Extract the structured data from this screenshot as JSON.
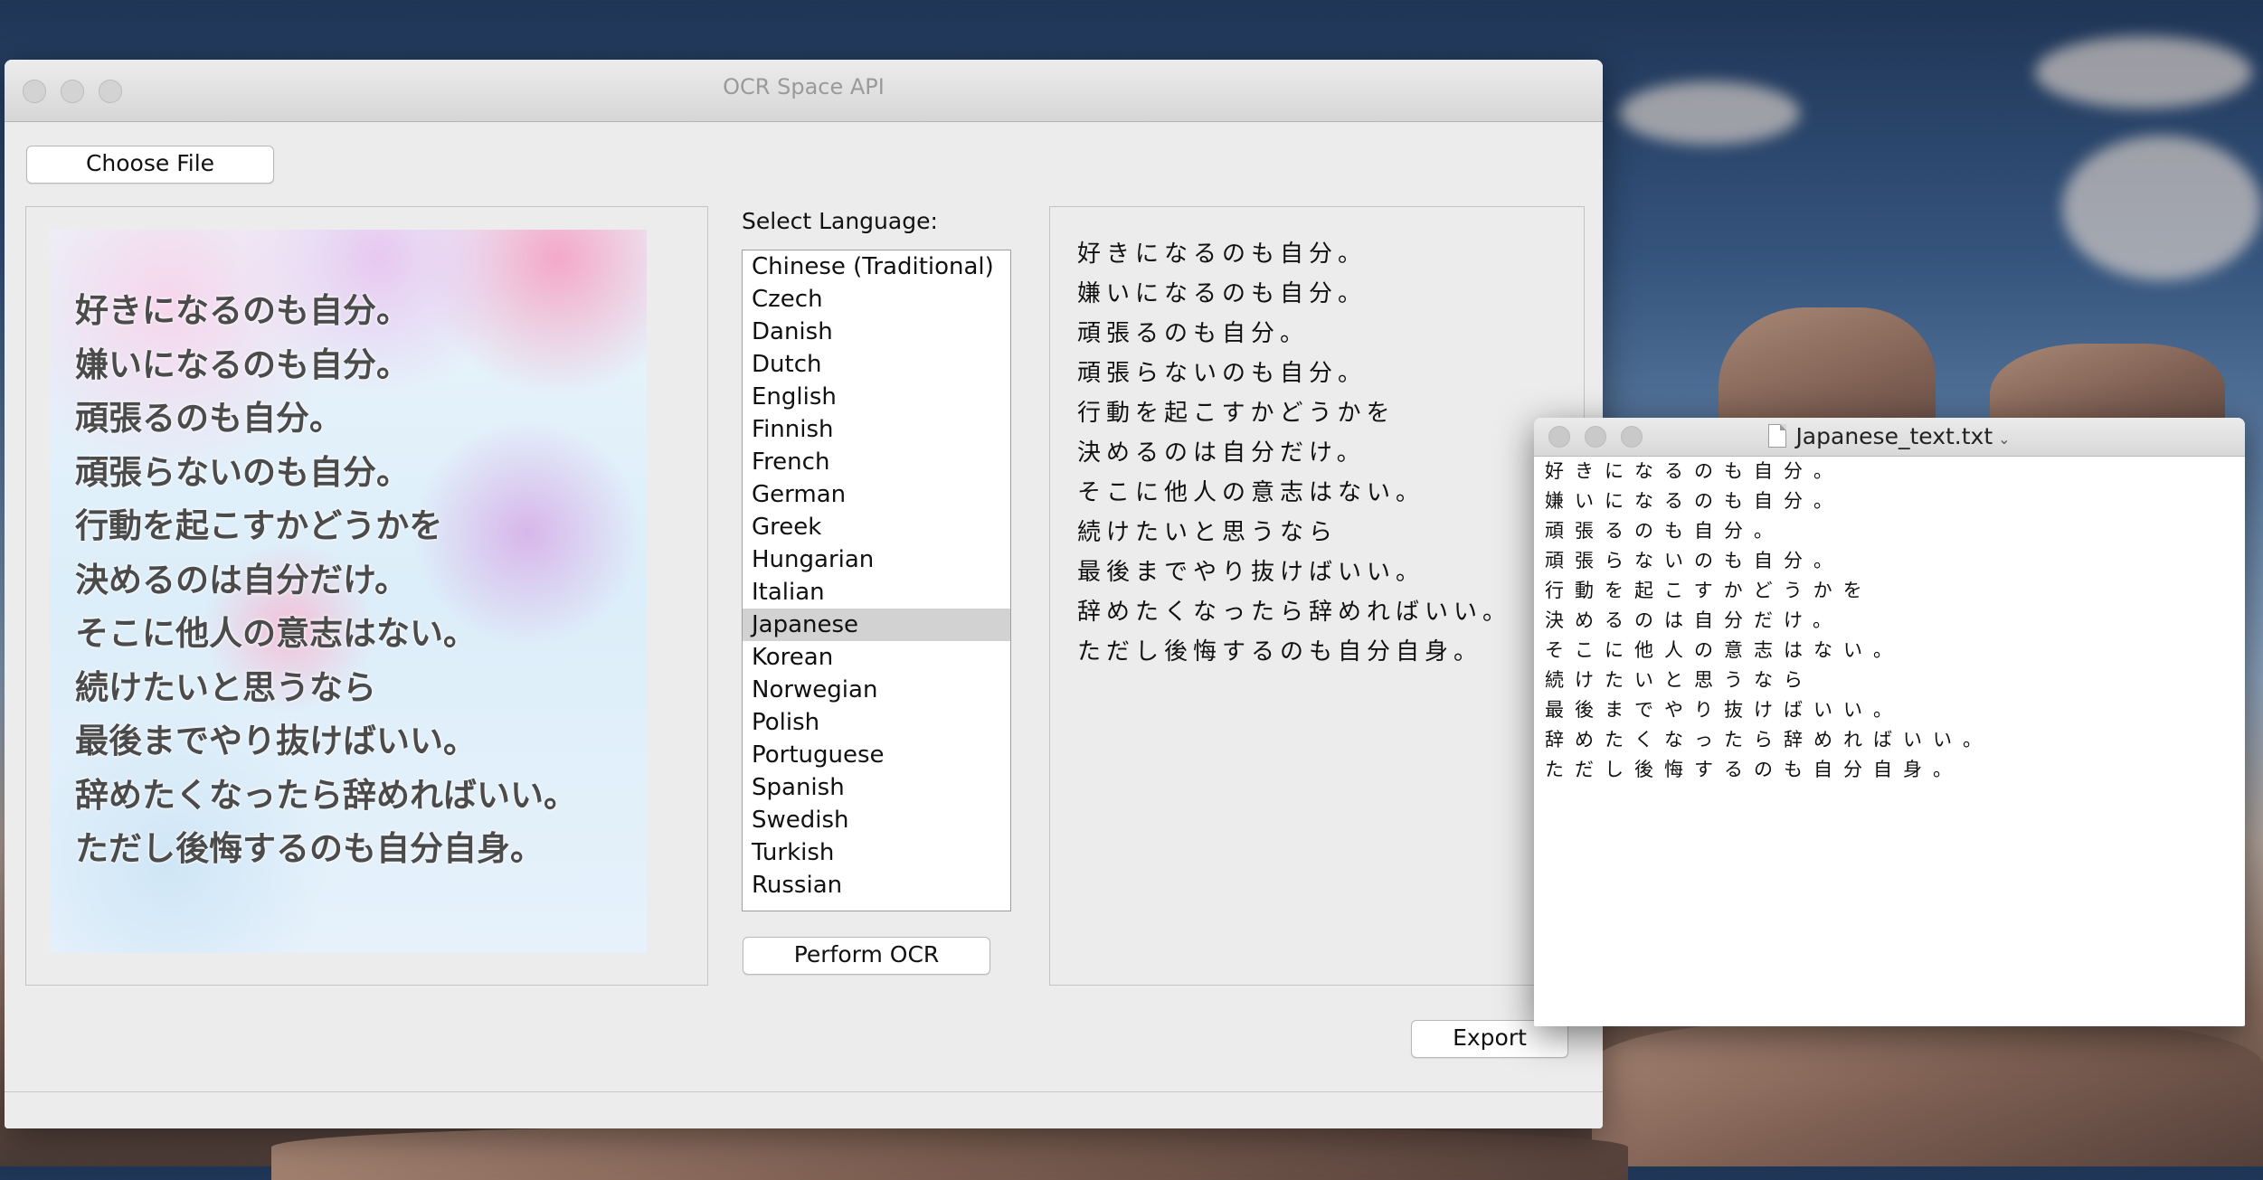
{
  "main_window": {
    "title": "OCR Space API",
    "choose_file_label": "Choose File",
    "select_language_label": "Select Language:",
    "languages": [
      {
        "label": "Chinese (Traditional)",
        "selected": false
      },
      {
        "label": "Czech",
        "selected": false
      },
      {
        "label": "Danish",
        "selected": false
      },
      {
        "label": "Dutch",
        "selected": false
      },
      {
        "label": "English",
        "selected": false
      },
      {
        "label": "Finnish",
        "selected": false
      },
      {
        "label": "French",
        "selected": false
      },
      {
        "label": "German",
        "selected": false
      },
      {
        "label": "Greek",
        "selected": false
      },
      {
        "label": "Hungarian",
        "selected": false
      },
      {
        "label": "Italian",
        "selected": false
      },
      {
        "label": "Japanese",
        "selected": true
      },
      {
        "label": "Korean",
        "selected": false
      },
      {
        "label": "Norwegian",
        "selected": false
      },
      {
        "label": "Polish",
        "selected": false
      },
      {
        "label": "Portuguese",
        "selected": false
      },
      {
        "label": "Spanish",
        "selected": false
      },
      {
        "label": "Swedish",
        "selected": false
      },
      {
        "label": "Turkish",
        "selected": false
      },
      {
        "label": "Russian",
        "selected": false
      }
    ],
    "perform_ocr_label": "Perform OCR",
    "export_label": "Export",
    "image_text_lines": [
      "好きになるのも自分。",
      "嫌いになるのも自分。",
      "頑張るのも自分。",
      "頑張らないのも自分。",
      "行動を起こすかどうかを",
      "決めるのは自分だけ。",
      "そこに他人の意志はない。",
      "続けたいと思うなら",
      "最後までやり抜けばいい。",
      "辞めたくなったら辞めればいい。",
      "ただし後悔するのも自分自身。"
    ],
    "ocr_result_lines": [
      "好きになるのも自分。",
      "嫌いになるのも自分。",
      "頑張るのも自分。",
      "頑張らないのも自分。",
      "行動を起こすかどうかを",
      "決めるのは自分だけ。",
      "そこに他人の意志はない。",
      "続けたいと思うなら",
      "最後までやり抜けばいい。",
      "辞めたくなったら辞めればいい。",
      "ただし後悔するのも自分自身。"
    ]
  },
  "editor_window": {
    "filename": "Japanese_text.txt",
    "filename_icon": "document-icon",
    "lines": [
      "好きになるのも自分。",
      "嫌いになるのも自分。",
      "頑張るのも自分。",
      "頑張らないのも自分。",
      "行動を起こすかどうかを",
      "決めるのは自分だけ。",
      "そこに他人の意志はない。",
      "続けたいと思うなら",
      "最後までやり抜けばいい。",
      "辞めたくなったら辞めればいい。",
      "ただし後悔するのも自分自身。"
    ]
  },
  "colors": {
    "selection": "#d2d2d2",
    "window_bg": "#ececec"
  }
}
